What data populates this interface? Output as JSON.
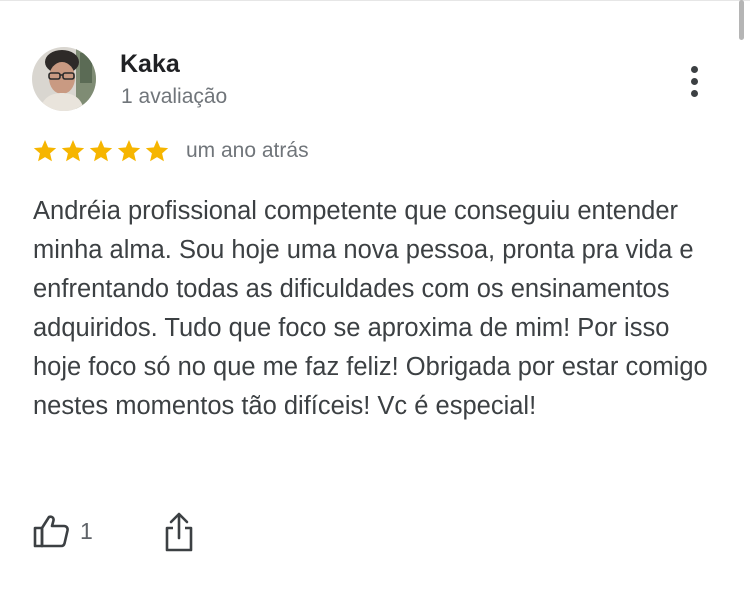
{
  "review": {
    "author_name": "Kaka",
    "author_reviews": "1 avaliação",
    "rating": 5,
    "rating_max": 5,
    "date": "um ano atrás",
    "text": "Andréia profissional competente que conseguiu entender minha alma. Sou hoje uma nova pessoa, pronta pra vida e enfrentando todas as dificuldades com os ensinamentos adquiridos. Tudo que foco se aproxima de mim! Por isso hoje foco só no que me faz feliz! Obrigada por estar comigo nestes momentos tão difíceis! Vc é especial!",
    "likes": "1"
  },
  "icons": {
    "avatar": "avatar-photo",
    "star": "star-icon",
    "more": "more-vert-icon",
    "like": "thumb-up-icon",
    "share": "share-icon"
  },
  "colors": {
    "star": "#F6B500",
    "name": "#202124",
    "secondary_text": "#70757A",
    "body_text": "#3C4043",
    "icon": "#3C4043"
  }
}
